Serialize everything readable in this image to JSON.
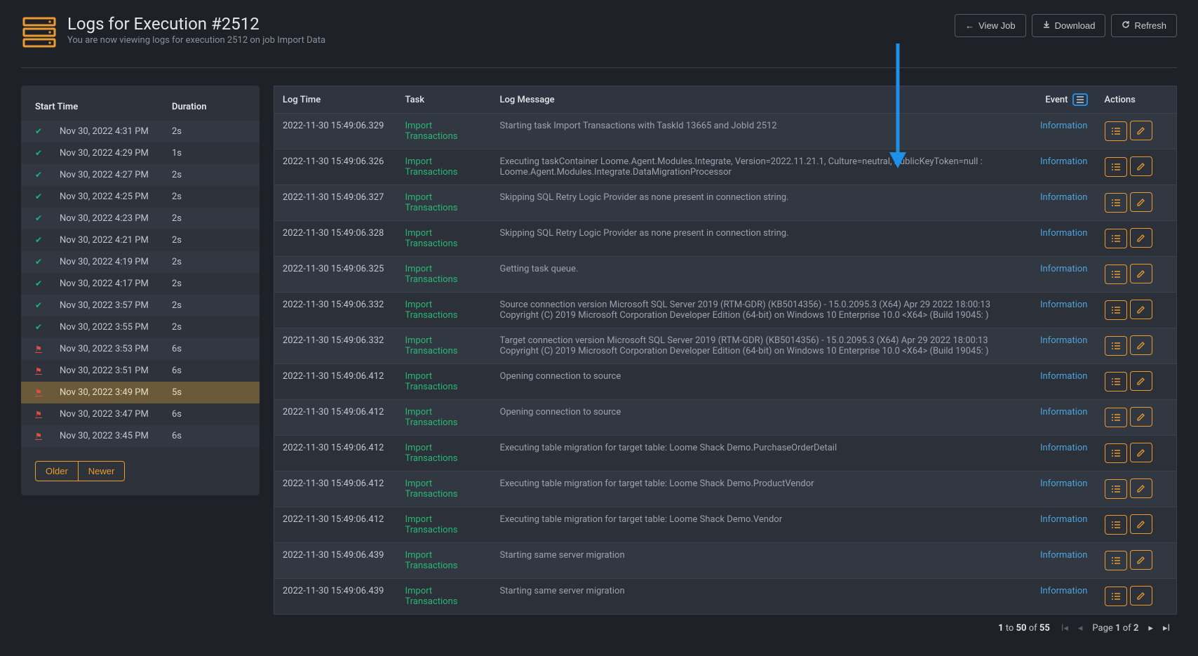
{
  "header": {
    "title": "Logs for Execution #2512",
    "subtitle": "You are now viewing logs for execution 2512 on job Import Data",
    "actions": {
      "view_job": "View Job",
      "download": "Download",
      "refresh": "Refresh"
    }
  },
  "sidebar": {
    "header_time": "Start Time",
    "header_duration": "Duration",
    "older": "Older",
    "newer": "Newer",
    "rows": [
      {
        "status": "ok",
        "time": "Nov 30, 2022 4:31 PM",
        "duration": "2s",
        "active": false
      },
      {
        "status": "ok",
        "time": "Nov 30, 2022 4:29 PM",
        "duration": "1s",
        "active": false
      },
      {
        "status": "ok",
        "time": "Nov 30, 2022 4:27 PM",
        "duration": "2s",
        "active": false
      },
      {
        "status": "ok",
        "time": "Nov 30, 2022 4:25 PM",
        "duration": "2s",
        "active": false
      },
      {
        "status": "ok",
        "time": "Nov 30, 2022 4:23 PM",
        "duration": "2s",
        "active": false
      },
      {
        "status": "ok",
        "time": "Nov 30, 2022 4:21 PM",
        "duration": "2s",
        "active": false
      },
      {
        "status": "ok",
        "time": "Nov 30, 2022 4:19 PM",
        "duration": "2s",
        "active": false
      },
      {
        "status": "ok",
        "time": "Nov 30, 2022 4:17 PM",
        "duration": "2s",
        "active": false
      },
      {
        "status": "ok",
        "time": "Nov 30, 2022 3:57 PM",
        "duration": "2s",
        "active": false
      },
      {
        "status": "ok",
        "time": "Nov 30, 2022 3:55 PM",
        "duration": "2s",
        "active": false
      },
      {
        "status": "fail",
        "time": "Nov 30, 2022 3:53 PM",
        "duration": "6s",
        "active": false
      },
      {
        "status": "fail",
        "time": "Nov 30, 2022 3:51 PM",
        "duration": "6s",
        "active": false
      },
      {
        "status": "fail",
        "time": "Nov 30, 2022 3:49 PM",
        "duration": "5s",
        "active": true
      },
      {
        "status": "fail",
        "time": "Nov 30, 2022 3:47 PM",
        "duration": "6s",
        "active": false
      },
      {
        "status": "fail",
        "time": "Nov 30, 2022 3:45 PM",
        "duration": "6s",
        "active": false
      }
    ]
  },
  "table": {
    "headers": {
      "logtime": "Log Time",
      "task": "Task",
      "message": "Log Message",
      "event": "Event",
      "actions": "Actions"
    },
    "rows": [
      {
        "time": "2022-11-30 15:49:06.329",
        "task": "Import Transactions",
        "msg": "Starting task Import Transactions with TaskId 13665 and JobId 2512",
        "event": "Information"
      },
      {
        "time": "2022-11-30 15:49:06.326",
        "task": "Import Transactions",
        "msg": "Executing taskContainer Loome.Agent.Modules.Integrate, Version=2022.11.21.1, Culture=neutral, PublicKeyToken=null : Loome.Agent.Modules.Integrate.DataMigrationProcessor",
        "event": "Information"
      },
      {
        "time": "2022-11-30 15:49:06.327",
        "task": "Import Transactions",
        "msg": "Skipping SQL Retry Logic Provider as none present in connection string.",
        "event": "Information"
      },
      {
        "time": "2022-11-30 15:49:06.328",
        "task": "Import Transactions",
        "msg": "Skipping SQL Retry Logic Provider as none present in connection string.",
        "event": "Information"
      },
      {
        "time": "2022-11-30 15:49:06.325",
        "task": "Import Transactions",
        "msg": "Getting task queue.",
        "event": "Information"
      },
      {
        "time": "2022-11-30 15:49:06.332",
        "task": "Import Transactions",
        "msg": "Source connection version Microsoft SQL Server 2019 (RTM-GDR) (KB5014356) - 15.0.2095.3 (X64) Apr 29 2022 18:00:13 Copyright (C) 2019 Microsoft Corporation Developer Edition (64-bit) on Windows 10 Enterprise 10.0 <X64> (Build 19045: )",
        "event": "Information"
      },
      {
        "time": "2022-11-30 15:49:06.332",
        "task": "Import Transactions",
        "msg": "Target connection version Microsoft SQL Server 2019 (RTM-GDR) (KB5014356) - 15.0.2095.3 (X64) Apr 29 2022 18:00:13 Copyright (C) 2019 Microsoft Corporation Developer Edition (64-bit) on Windows 10 Enterprise 10.0 <X64> (Build 19045: )",
        "event": "Information"
      },
      {
        "time": "2022-11-30 15:49:06.412",
        "task": "Import Transactions",
        "msg": "Opening connection to source",
        "event": "Information"
      },
      {
        "time": "2022-11-30 15:49:06.412",
        "task": "Import Transactions",
        "msg": "Opening connection to source",
        "event": "Information"
      },
      {
        "time": "2022-11-30 15:49:06.412",
        "task": "Import Transactions",
        "msg": "Executing table migration for target table: Loome Shack Demo.PurchaseOrderDetail",
        "event": "Information"
      },
      {
        "time": "2022-11-30 15:49:06.412",
        "task": "Import Transactions",
        "msg": "Executing table migration for target table: Loome Shack Demo.ProductVendor",
        "event": "Information"
      },
      {
        "time": "2022-11-30 15:49:06.412",
        "task": "Import Transactions",
        "msg": "Executing table migration for target table: Loome Shack Demo.Vendor",
        "event": "Information"
      },
      {
        "time": "2022-11-30 15:49:06.439",
        "task": "Import Transactions",
        "msg": "Starting same server migration",
        "event": "Information"
      },
      {
        "time": "2022-11-30 15:49:06.439",
        "task": "Import Transactions",
        "msg": "Starting same server migration",
        "event": "Information"
      }
    ]
  },
  "pagination": {
    "range_from": "1",
    "range_to": "50",
    "range_total": "55",
    "to_word": "to",
    "of_word": "of",
    "page_word": "Page",
    "page_current": "1",
    "page_total": "2"
  }
}
